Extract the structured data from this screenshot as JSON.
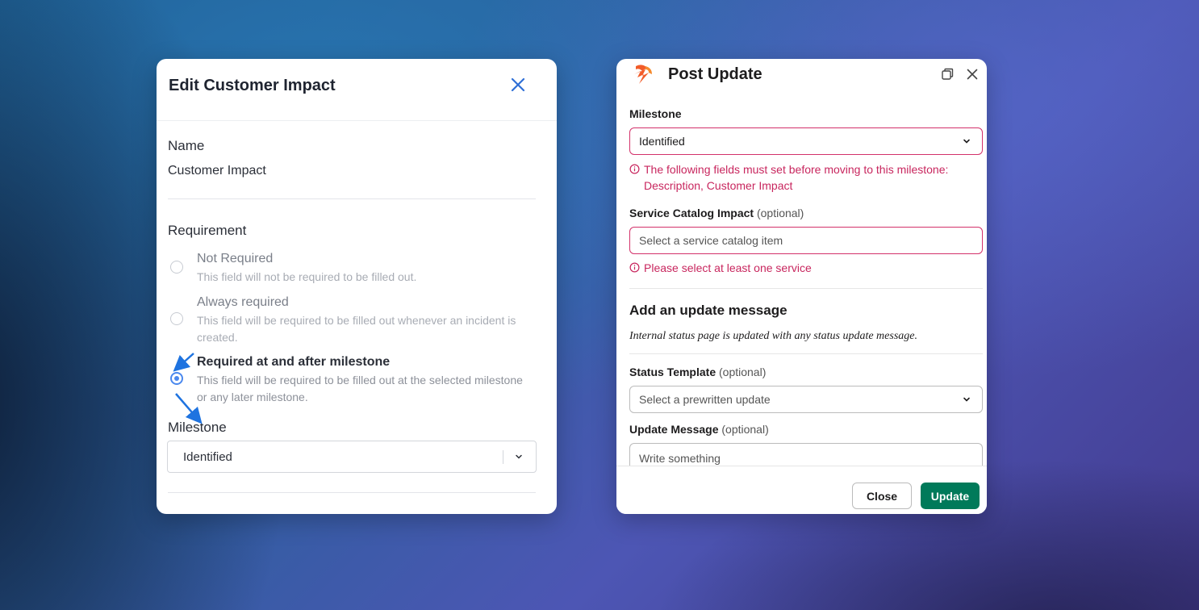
{
  "left_modal": {
    "title": "Edit Customer Impact",
    "name_label": "Name",
    "name_value": "Customer Impact",
    "requirement_label": "Requirement",
    "options": [
      {
        "title": "Not Required",
        "description": "This field will not be required to be filled out.",
        "selected": false
      },
      {
        "title": "Always required",
        "description": "This field will be required to be filled out whenever an incident is created.",
        "selected": false
      },
      {
        "title": "Required at and after milestone",
        "description": "This field will be required to be filled out at the selected milestone or any later milestone.",
        "selected": true
      }
    ],
    "milestone_label": "Milestone",
    "milestone_value": "Identified"
  },
  "right_modal": {
    "title": "Post Update",
    "milestone": {
      "label": "Milestone",
      "value": "Identified",
      "error": "The following fields must set before moving to this milestone: Description, Customer Impact"
    },
    "service_catalog": {
      "label": "Service Catalog Impact",
      "optional": "(optional)",
      "placeholder": "Select a service catalog item",
      "error": "Please select at least one service"
    },
    "section_title": "Add an update message",
    "section_note": "Internal status page is updated with any status update message.",
    "status_template": {
      "label": "Status Template",
      "optional": "(optional)",
      "placeholder": "Select a prewritten update"
    },
    "update_message": {
      "label": "Update Message",
      "optional": "(optional)",
      "placeholder": "Write something"
    },
    "close_label": "Close",
    "update_label": "Update"
  },
  "colors": {
    "accent_blue": "#4a88ee",
    "error_red": "#c8265e",
    "update_green": "#007a5a",
    "logo_orange": "#f25c29"
  },
  "icons": [
    "close-icon",
    "chevron-down-icon",
    "logo-icon",
    "maximize-icon",
    "info-icon",
    "arrow-annotation-icon"
  ]
}
